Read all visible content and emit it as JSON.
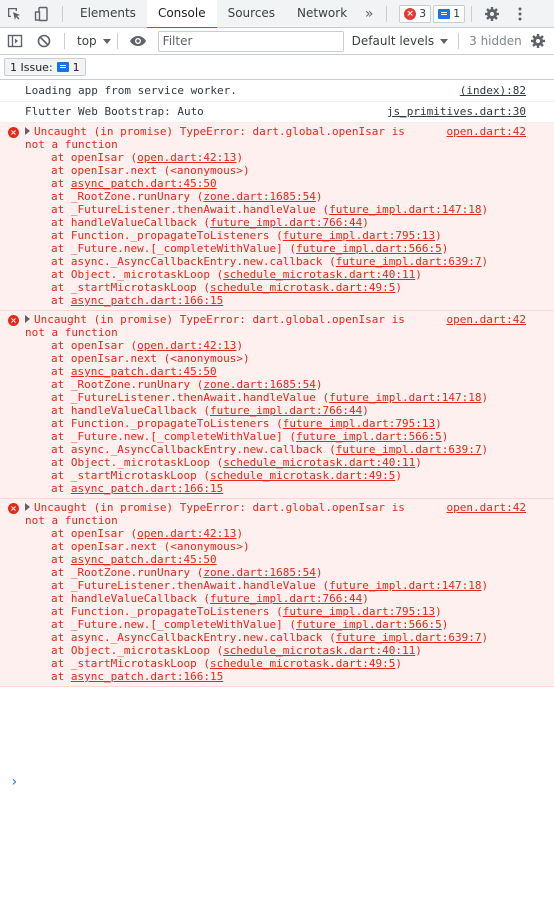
{
  "tabs": {
    "elements": "Elements",
    "console": "Console",
    "sources": "Sources",
    "network": "Network",
    "more": "»",
    "error_count": "3",
    "message_count": "1"
  },
  "toolbar": {
    "context": "top",
    "filter_placeholder": "Filter",
    "levels": "Default levels",
    "hidden": "3 hidden"
  },
  "issues": {
    "label": "1 Issue:",
    "count": "1"
  },
  "messages": [
    {
      "text": "Loading app from service worker.",
      "source": "(index):82"
    },
    {
      "text": "Flutter Web Bootstrap: Auto",
      "source": "js_primitives.dart:30"
    }
  ],
  "errors": [
    {
      "text": "Uncaught (in promise) TypeError: dart.global.openIsar is not a function",
      "source": "open.dart:42",
      "frames": [
        {
          "pre": "at openIsar (",
          "link": "open.dart:42:13",
          "post": ")"
        },
        {
          "pre": "at openIsar.next (<anonymous>)",
          "link": "",
          "post": ""
        },
        {
          "pre": "at ",
          "link": "async_patch.dart:45:50",
          "post": ""
        },
        {
          "pre": "at _RootZone.runUnary (",
          "link": "zone.dart:1685:54",
          "post": ")"
        },
        {
          "pre": "at _FutureListener.thenAwait.handleValue (",
          "link": "future_impl.dart:147:18",
          "post": ")"
        },
        {
          "pre": "at handleValueCallback (",
          "link": "future_impl.dart:766:44",
          "post": ")"
        },
        {
          "pre": "at Function._propagateToListeners (",
          "link": "future_impl.dart:795:13",
          "post": ")"
        },
        {
          "pre": "at _Future.new.[_completeWithValue] (",
          "link": "future_impl.dart:566:5",
          "post": ")"
        },
        {
          "pre": "at async._AsyncCallbackEntry.new.callback (",
          "link": "future_impl.dart:639:7",
          "post": ")"
        },
        {
          "pre": "at Object._microtaskLoop (",
          "link": "schedule_microtask.dart:40:11",
          "post": ")"
        },
        {
          "pre": "at _startMicrotaskLoop (",
          "link": "schedule_microtask.dart:49:5",
          "post": ")"
        },
        {
          "pre": "at ",
          "link": "async_patch.dart:166:15",
          "post": ""
        }
      ]
    },
    {
      "text": "Uncaught (in promise) TypeError: dart.global.openIsar is not a function",
      "source": "open.dart:42",
      "frames": [
        {
          "pre": "at openIsar (",
          "link": "open.dart:42:13",
          "post": ")"
        },
        {
          "pre": "at openIsar.next (<anonymous>)",
          "link": "",
          "post": ""
        },
        {
          "pre": "at ",
          "link": "async_patch.dart:45:50",
          "post": ""
        },
        {
          "pre": "at _RootZone.runUnary (",
          "link": "zone.dart:1685:54",
          "post": ")"
        },
        {
          "pre": "at _FutureListener.thenAwait.handleValue (",
          "link": "future_impl.dart:147:18",
          "post": ")"
        },
        {
          "pre": "at handleValueCallback (",
          "link": "future_impl.dart:766:44",
          "post": ")"
        },
        {
          "pre": "at Function._propagateToListeners (",
          "link": "future_impl.dart:795:13",
          "post": ")"
        },
        {
          "pre": "at _Future.new.[_completeWithValue] (",
          "link": "future_impl.dart:566:5",
          "post": ")"
        },
        {
          "pre": "at async._AsyncCallbackEntry.new.callback (",
          "link": "future_impl.dart:639:7",
          "post": ")"
        },
        {
          "pre": "at Object._microtaskLoop (",
          "link": "schedule_microtask.dart:40:11",
          "post": ")"
        },
        {
          "pre": "at _startMicrotaskLoop (",
          "link": "schedule_microtask.dart:49:5",
          "post": ")"
        },
        {
          "pre": "at ",
          "link": "async_patch.dart:166:15",
          "post": ""
        }
      ]
    },
    {
      "text": "Uncaught (in promise) TypeError: dart.global.openIsar is not a function",
      "source": "open.dart:42",
      "frames": [
        {
          "pre": "at openIsar (",
          "link": "open.dart:42:13",
          "post": ")"
        },
        {
          "pre": "at openIsar.next (<anonymous>)",
          "link": "",
          "post": ""
        },
        {
          "pre": "at ",
          "link": "async_patch.dart:45:50",
          "post": ""
        },
        {
          "pre": "at _RootZone.runUnary (",
          "link": "zone.dart:1685:54",
          "post": ")"
        },
        {
          "pre": "at _FutureListener.thenAwait.handleValue (",
          "link": "future_impl.dart:147:18",
          "post": ")"
        },
        {
          "pre": "at handleValueCallback (",
          "link": "future_impl.dart:766:44",
          "post": ")"
        },
        {
          "pre": "at Function._propagateToListeners (",
          "link": "future_impl.dart:795:13",
          "post": ")"
        },
        {
          "pre": "at _Future.new.[_completeWithValue] (",
          "link": "future_impl.dart:566:5",
          "post": ")"
        },
        {
          "pre": "at async._AsyncCallbackEntry.new.callback (",
          "link": "future_impl.dart:639:7",
          "post": ")"
        },
        {
          "pre": "at Object._microtaskLoop (",
          "link": "schedule_microtask.dart:40:11",
          "post": ")"
        },
        {
          "pre": "at _startMicrotaskLoop (",
          "link": "schedule_microtask.dart:49:5",
          "post": ")"
        },
        {
          "pre": "at ",
          "link": "async_patch.dart:166:15",
          "post": ""
        }
      ]
    }
  ],
  "prompt": "›",
  "colors": {
    "accent": "#1a73e8",
    "error_text": "#e2291b",
    "error_bg": "#fff0f0"
  },
  "icons": [
    "inspect-icon",
    "device-toggle-icon",
    "sidebar-toggle-icon",
    "clear-console-icon",
    "eye-icon",
    "gear-icon"
  ]
}
